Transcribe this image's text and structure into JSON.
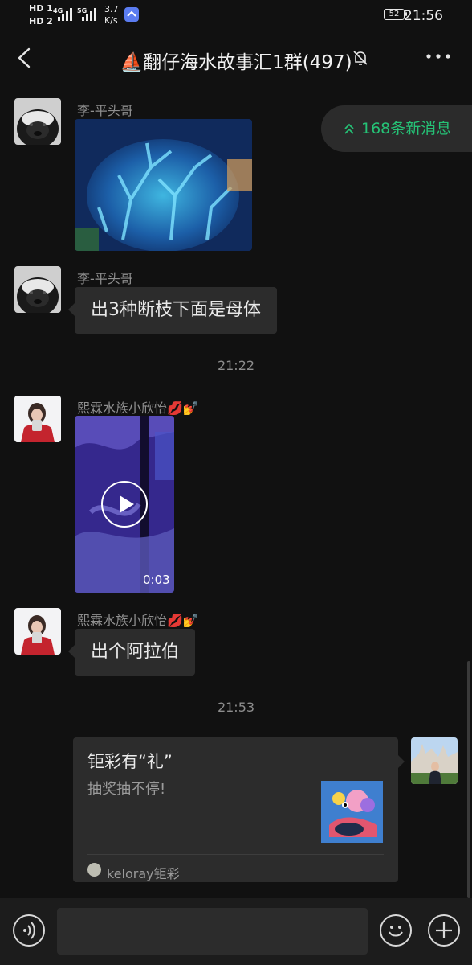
{
  "status_bar": {
    "network1": "HD 1",
    "network2": "HD 2",
    "gen1": "4G",
    "gen2": "5G",
    "speed_value": "3.7",
    "speed_unit": "K/s",
    "battery": "52",
    "time": "21:56"
  },
  "header": {
    "title": "⛵翻仔海水故事汇1群(497)",
    "icons": {
      "back": "back-arrow-icon",
      "mute": "mute-bell-icon",
      "more": "more-dots-icon"
    }
  },
  "new_messages": {
    "label": "168条新消息",
    "icon": "double-chevron-up-icon",
    "color": "#25c276"
  },
  "messages": [
    {
      "sender": "李-平头哥",
      "type": "image"
    },
    {
      "sender": "李-平头哥",
      "type": "text",
      "text": "出3种断枝下面是母体"
    },
    {
      "type": "time",
      "text": "21:22"
    },
    {
      "sender": "熙霖水族小欣怡💋💅",
      "type": "video",
      "duration": "0:03"
    },
    {
      "sender": "熙霖水族小欣怡💋💅",
      "type": "text",
      "text": "出个阿拉伯"
    },
    {
      "type": "time",
      "text": "21:53"
    },
    {
      "type": "card",
      "title": "钜彩有“礼”",
      "desc": "抽奖抽不停!",
      "source": "keloray钜彩"
    }
  ],
  "bottom_bar": {
    "icons": {
      "voice": "voice-icon",
      "emoji": "emoji-icon",
      "plus": "plus-icon"
    }
  }
}
